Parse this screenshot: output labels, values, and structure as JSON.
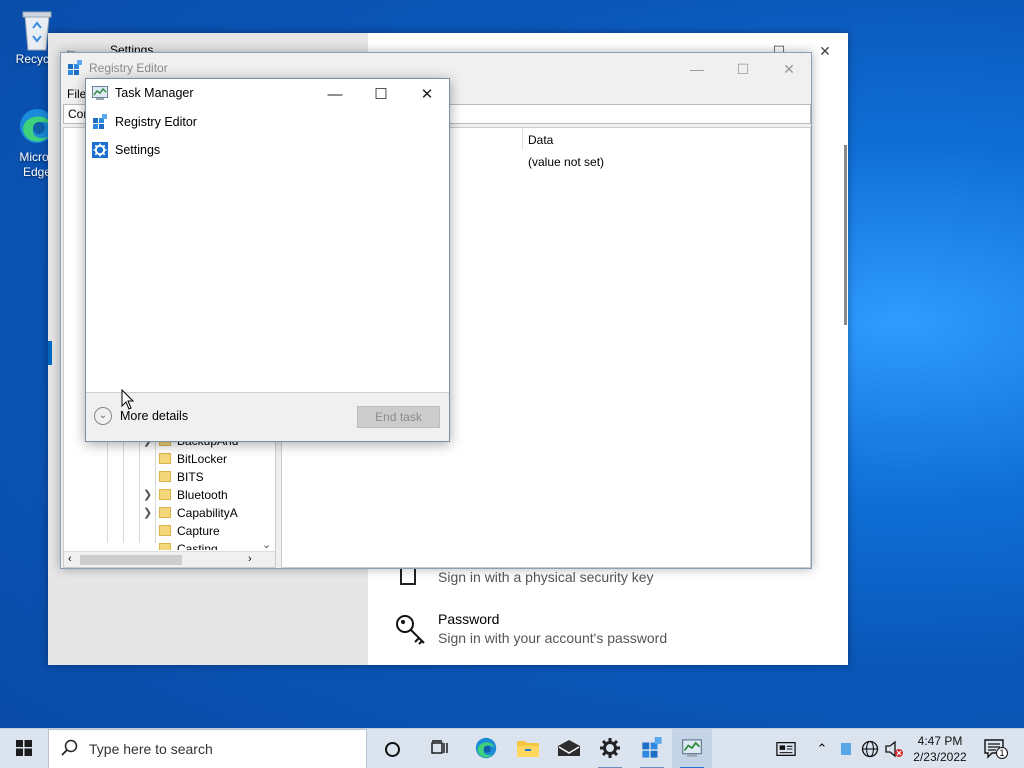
{
  "desktop": {
    "icons": [
      {
        "label": "Recycle",
        "icon": "recycle-bin-icon"
      },
      {
        "label": "Micros\nEdge",
        "icon": "edge-icon"
      }
    ]
  },
  "settings_window": {
    "title": "Settings",
    "options": [
      {
        "title": "",
        "desc": "Sign in with a physical security key",
        "icon": "security-key-icon"
      },
      {
        "title": "Password",
        "desc": "Sign in with your account's password",
        "icon": "key-icon"
      }
    ]
  },
  "registry_editor": {
    "title": "Registry Editor",
    "menu_first": "File",
    "address_text": "Cor",
    "columns": {
      "data": "Data"
    },
    "default_value": "(value not set)",
    "tree_items": [
      "BackupAnd",
      "BitLocker",
      "BITS",
      "Bluetooth",
      "CapabilityA",
      "Capture",
      "Casting"
    ]
  },
  "task_manager": {
    "title": "Task Manager",
    "apps": [
      {
        "label": "Registry Editor",
        "icon": "regedit-icon"
      },
      {
        "label": "Settings",
        "icon": "gear-icon"
      }
    ],
    "more_details": "More details",
    "end_task": "End task"
  },
  "taskbar": {
    "search_placeholder": "Type here to search",
    "time": "4:47 PM",
    "date": "2/23/2022",
    "notification_count": "1",
    "accent": "#2b6fd6"
  }
}
